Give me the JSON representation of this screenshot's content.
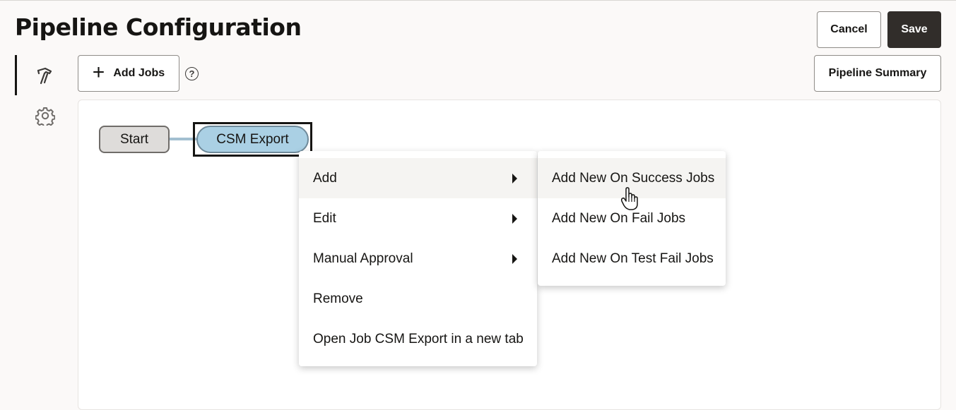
{
  "header": {
    "title": "Pipeline Configuration",
    "cancel_label": "Cancel",
    "save_label": "Save"
  },
  "toolbar": {
    "add_jobs_label": "Add Jobs",
    "help_symbol": "?",
    "pipeline_summary_label": "Pipeline Summary"
  },
  "sidebar": {
    "items": [
      {
        "icon": "hammer-icon",
        "active": true
      },
      {
        "icon": "gear-icon",
        "active": false
      }
    ]
  },
  "pipeline": {
    "nodes": [
      {
        "label": "Start",
        "type": "start"
      },
      {
        "label": "CSM Export",
        "type": "job",
        "selected": true
      }
    ]
  },
  "context_menu": {
    "items": [
      {
        "label": "Add",
        "submenu": true,
        "active": true
      },
      {
        "label": "Edit",
        "submenu": true
      },
      {
        "label": "Manual Approval",
        "submenu": true
      },
      {
        "label": "Remove",
        "submenu": false
      },
      {
        "label": "Open Job CSM Export in a new tab",
        "submenu": false
      }
    ]
  },
  "submenu": {
    "items": [
      {
        "label": "Add New On Success Jobs",
        "hovered": true
      },
      {
        "label": "Add New On Fail Jobs"
      },
      {
        "label": "Add New On Test Fail Jobs"
      }
    ]
  },
  "colors": {
    "primary_button": "#312d2a",
    "job_node": "#aad0e4",
    "start_node": "#dedcda",
    "connector": "#a3bfd0"
  }
}
